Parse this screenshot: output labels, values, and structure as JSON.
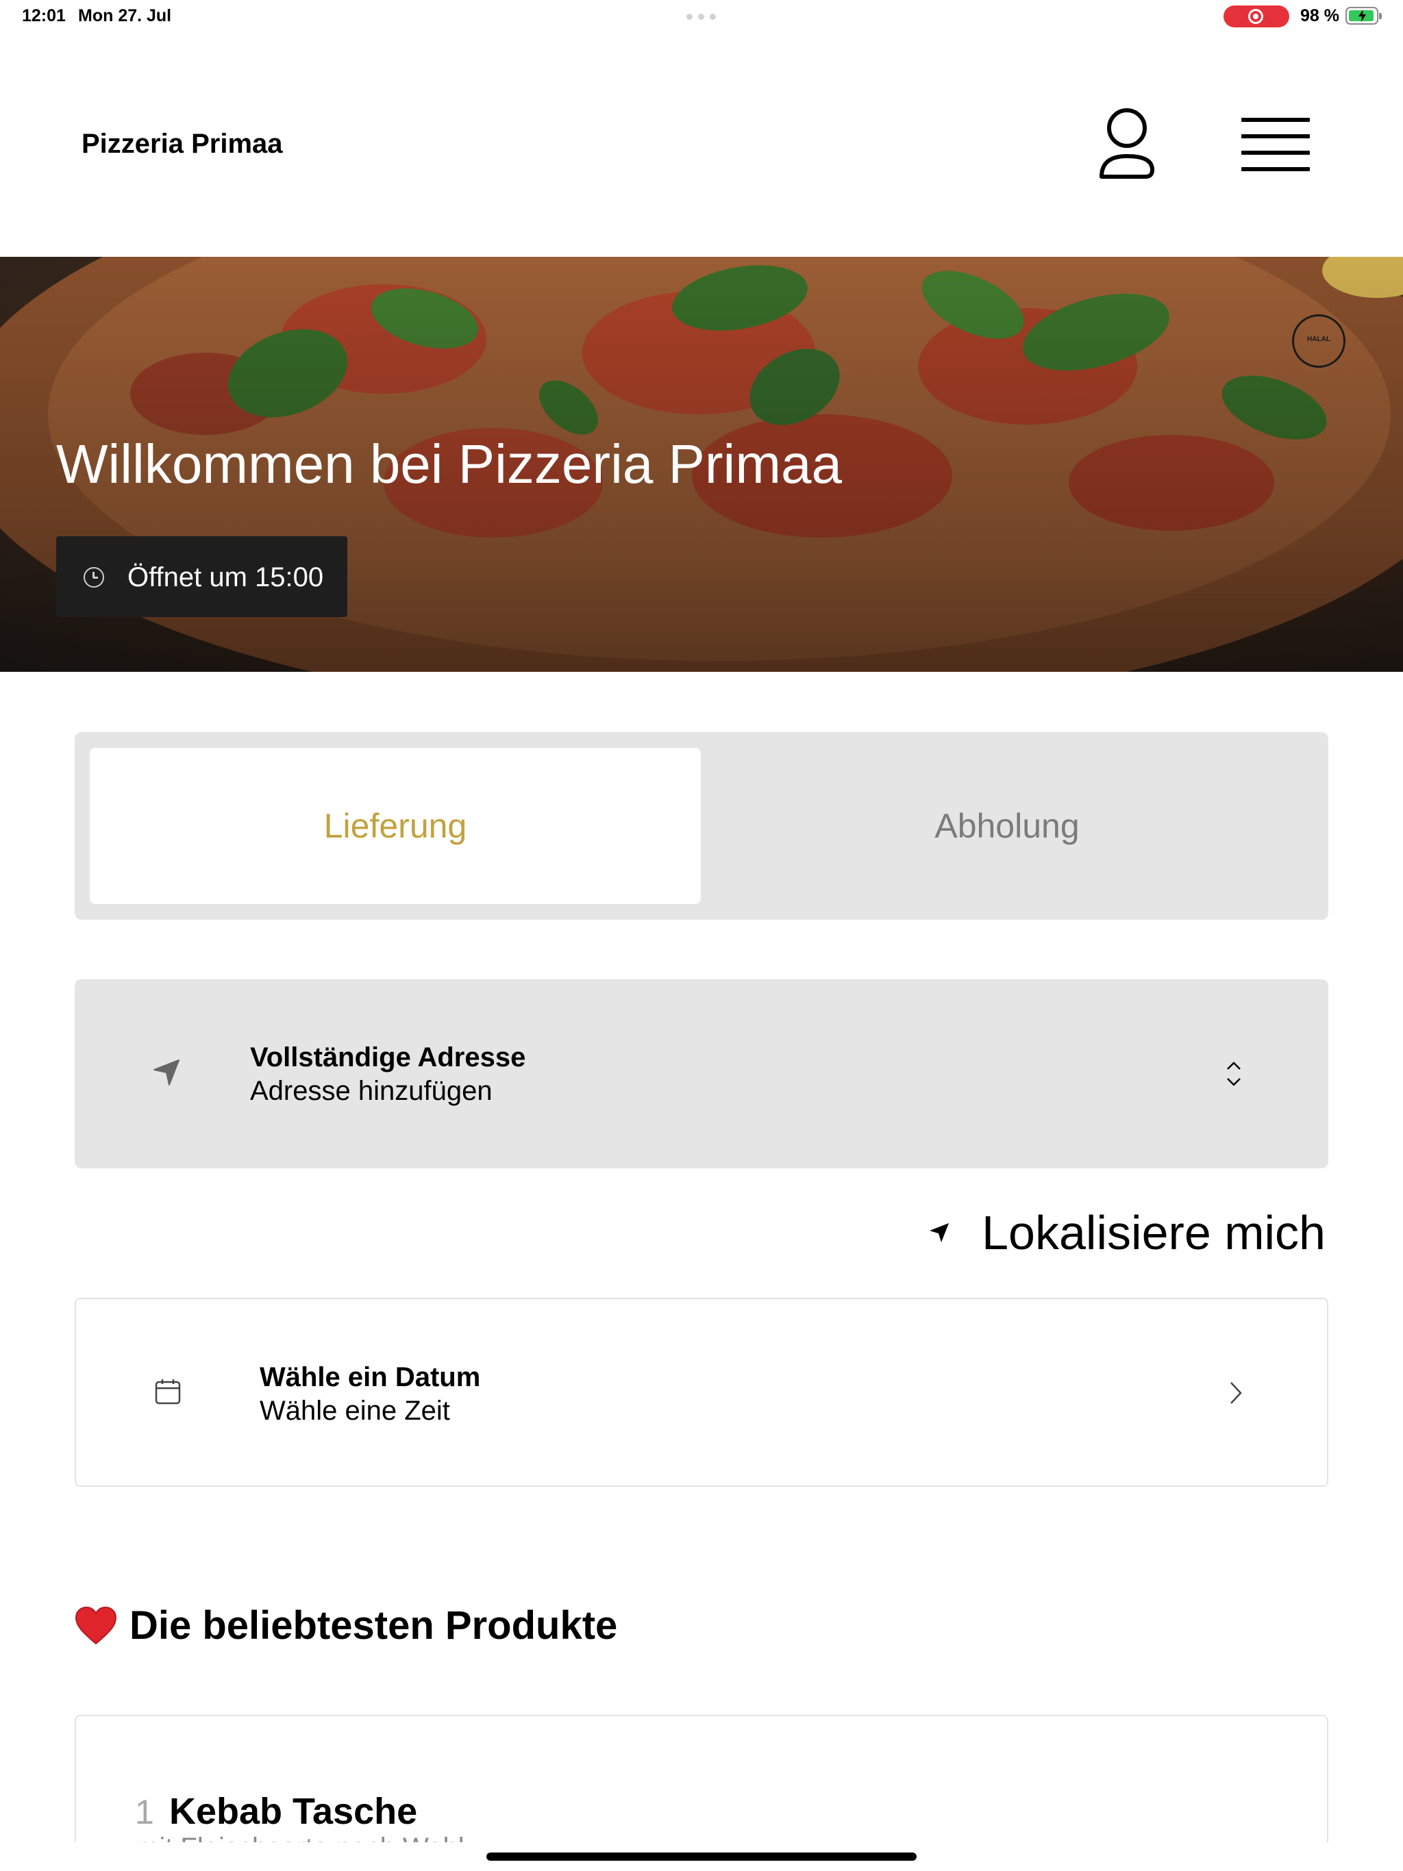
{
  "status_bar": {
    "time": "12:01",
    "date": "Mon 27. Jul",
    "battery": "98 %",
    "recording_color": "#e5323a",
    "battery_color": "#34c759"
  },
  "header": {
    "brand": "Pizzeria Primaa",
    "icons": [
      "user-icon",
      "menu-icon"
    ]
  },
  "hero": {
    "title": "Willkommen bei Pizzeria Primaa",
    "opening": "Öffnet um 15:00",
    "badge_logo_text": "HALAL"
  },
  "mode_tabs": {
    "delivery": "Lieferung",
    "pickup": "Abholung",
    "active": "delivery",
    "accent_color": "#c2a23e"
  },
  "address": {
    "title": "Vollständige Adresse",
    "placeholder": "Adresse hinzufügen"
  },
  "locate": {
    "label": "Lokalisiere mich"
  },
  "schedule": {
    "date_label": "Wähle ein Datum",
    "time_label": "Wähle eine Zeit"
  },
  "popular": {
    "title": "Die beliebtesten Produkte",
    "products": [
      {
        "rank": "1",
        "name": "Kebab Tasche",
        "desc": "mit Fleischsorte nach Wahl"
      }
    ]
  }
}
